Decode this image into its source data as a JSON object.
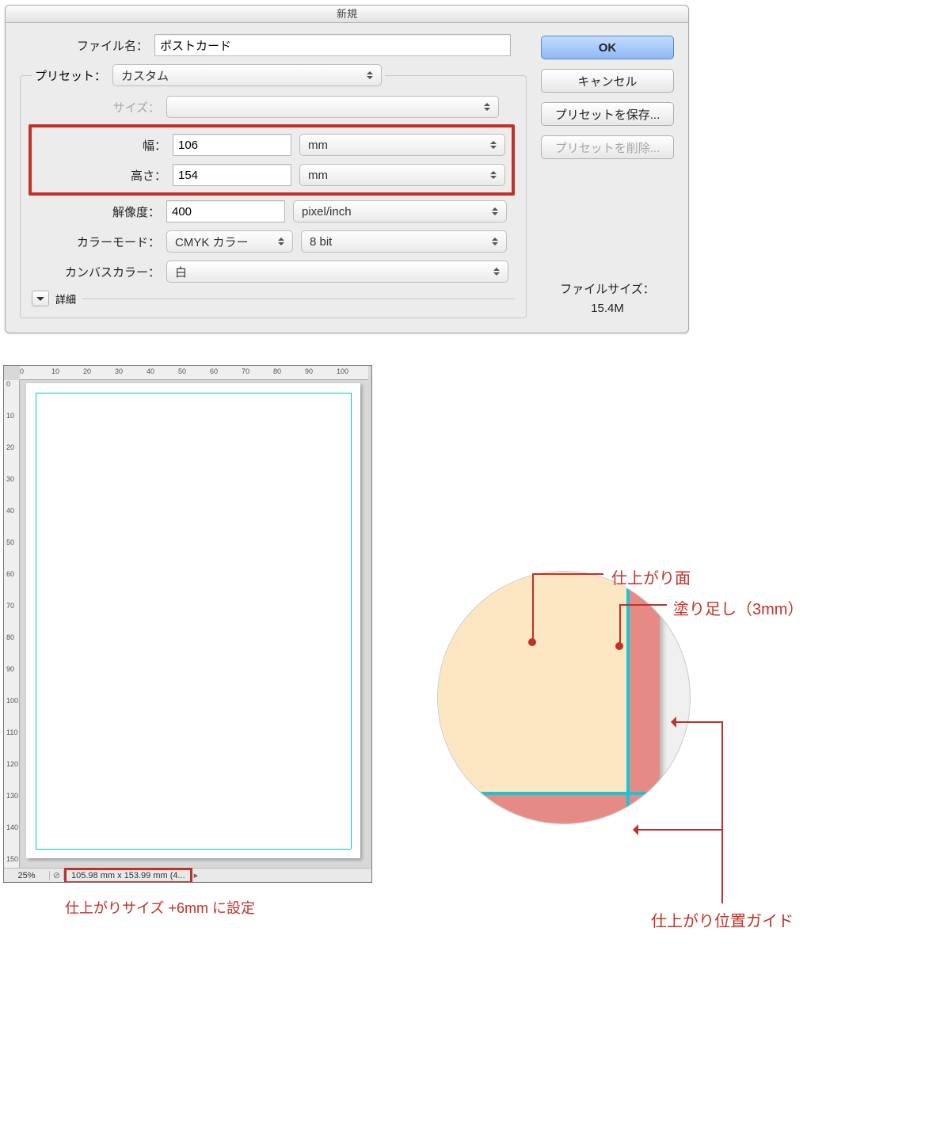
{
  "dialog": {
    "title": "新規",
    "filename_label": "ファイル名：",
    "filename_value": "ポストカード",
    "preset_label": "プリセット：",
    "preset_value": "カスタム",
    "size_label": "サイズ：",
    "width_label": "幅：",
    "width_value": "106",
    "width_unit": "mm",
    "height_label": "高さ：",
    "height_value": "154",
    "height_unit": "mm",
    "res_label": "解像度：",
    "res_value": "400",
    "res_unit": "pixel/inch",
    "colormode_label": "カラーモード：",
    "colormode_value": "CMYK カラー",
    "colormode_bit": "8 bit",
    "canvas_label": "カンバスカラー：",
    "canvas_value": "白",
    "detail_label": "詳細",
    "ok": "OK",
    "cancel": "キャンセル",
    "save_preset": "プリセットを保存...",
    "delete_preset": "プリセットを削除...",
    "filesize_label": "ファイルサイズ：",
    "filesize_value": "15.4M"
  },
  "canvas_preview": {
    "hruler": [
      "0",
      "10",
      "20",
      "30",
      "40",
      "50",
      "60",
      "70",
      "80",
      "90",
      "100"
    ],
    "vruler": [
      "0",
      "10",
      "20",
      "30",
      "40",
      "50",
      "60",
      "70",
      "80",
      "90",
      "100",
      "110",
      "120",
      "130",
      "140",
      "150"
    ],
    "zoom": "25%",
    "status_dim": "105.98 mm x 153.99 mm (4...",
    "caption": "仕上がりサイズ +6mm に設定"
  },
  "callouts": {
    "trim": "仕上がり面",
    "bleed": "塗り足し（3mm）",
    "guide": "仕上がり位置ガイド"
  }
}
